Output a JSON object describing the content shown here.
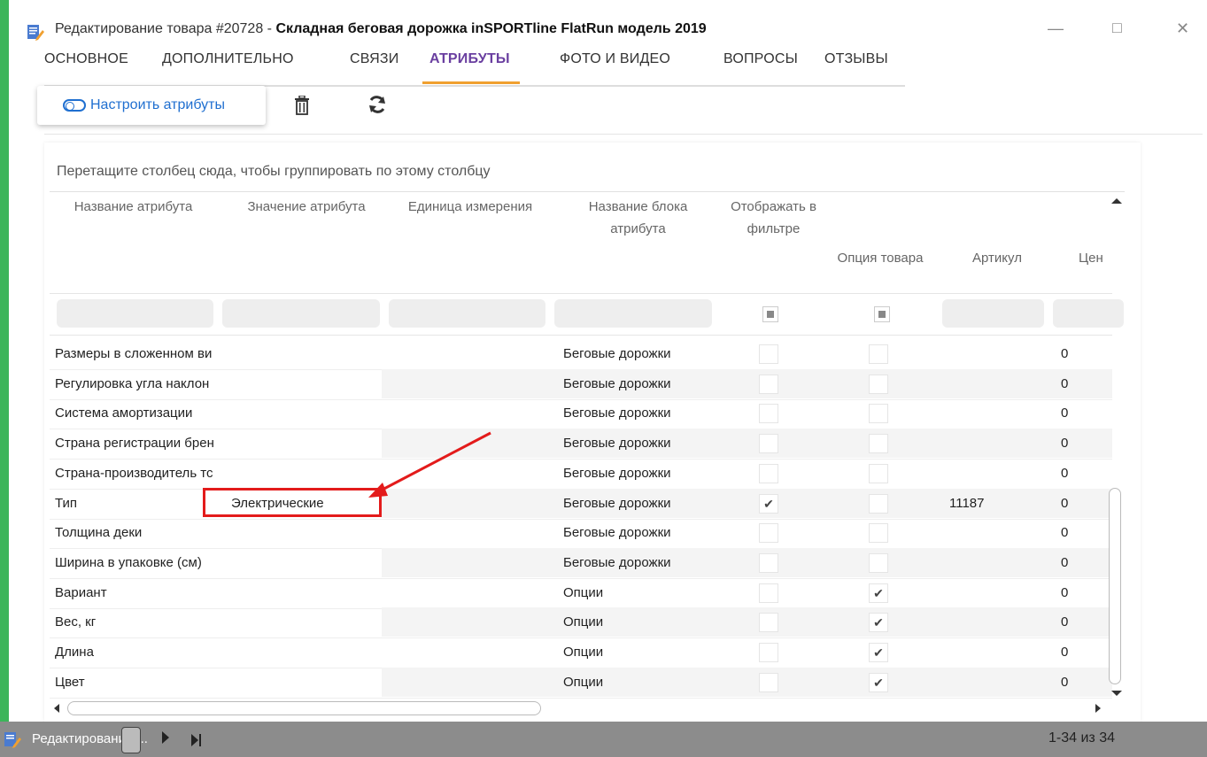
{
  "window": {
    "title_prefix": "Редактирование товара #20728 - ",
    "title_product": "Складная беговая дорожка inSPORTline FlatRun модель 2019"
  },
  "tabs": [
    {
      "label": "ОСНОВНОЕ"
    },
    {
      "label": "ДОПОЛНИТЕЛЬНО"
    },
    {
      "label": "СВЯЗИ"
    },
    {
      "label": "АТРИБУТЫ"
    },
    {
      "label": "ФОТО И ВИДЕО"
    },
    {
      "label": "ВОПРОСЫ"
    },
    {
      "label": "ОТЗЫВЫ"
    }
  ],
  "toolbar": {
    "configure_label": "Настроить атрибуты"
  },
  "grid": {
    "group_hint": "Перетащите столбец сюда, чтобы группировать по этому столбцу",
    "headers": {
      "name": "Название атрибута",
      "value": "Значение атрибута",
      "unit": "Единица измерения",
      "block_line1": "Название блока",
      "block_line2": "атрибута",
      "filter_line1": "Отображать в",
      "filter_line2": "фильтре",
      "option": "Опция товара",
      "sku": "Артикул",
      "price": "Цен"
    },
    "rows": [
      {
        "name": "Размеры в сложенном ви",
        "value": "",
        "block": "Беговые дорожки",
        "filter": false,
        "option": false,
        "sku": "",
        "price": "0"
      },
      {
        "name": "Регулировка угла наклон",
        "value": "",
        "block": "Беговые дорожки",
        "filter": false,
        "option": false,
        "sku": "",
        "price": "0"
      },
      {
        "name": "Система амортизации",
        "value": "",
        "block": "Беговые дорожки",
        "filter": false,
        "option": false,
        "sku": "",
        "price": "0"
      },
      {
        "name": "Страна регистрации брен",
        "value": "",
        "block": "Беговые дорожки",
        "filter": false,
        "option": false,
        "sku": "",
        "price": "0"
      },
      {
        "name": "Страна-производитель тс",
        "value": "",
        "block": "Беговые дорожки",
        "filter": false,
        "option": false,
        "sku": "",
        "price": "0"
      },
      {
        "name": "Тип",
        "value": "Электрические",
        "block": "Беговые дорожки",
        "filter": true,
        "option": false,
        "sku": "11187",
        "price": "0"
      },
      {
        "name": "Толщина деки",
        "value": "",
        "block": "Беговые дорожки",
        "filter": false,
        "option": false,
        "sku": "",
        "price": "0"
      },
      {
        "name": "Ширина в упаковке (см)",
        "value": "",
        "block": "Беговые дорожки",
        "filter": false,
        "option": false,
        "sku": "",
        "price": "0"
      },
      {
        "name": "Вариант",
        "value": "",
        "block": "Опции",
        "filter": false,
        "option": true,
        "sku": "",
        "price": "0"
      },
      {
        "name": "Вес, кг",
        "value": "",
        "block": "Опции",
        "filter": false,
        "option": true,
        "sku": "",
        "price": "0"
      },
      {
        "name": "Длина",
        "value": "",
        "block": "Опции",
        "filter": false,
        "option": true,
        "sku": "",
        "price": "0"
      },
      {
        "name": "Цвет",
        "value": "",
        "block": "Опции",
        "filter": false,
        "option": true,
        "sku": "",
        "price": "0"
      }
    ]
  },
  "taskbar": {
    "item_label": "Редактирование ...",
    "pager_text": "1-34 из 34"
  },
  "colors": {
    "accent_tab": "#6a3fa0",
    "tab_underline": "#f0a030",
    "button_blue": "#1f6fd0",
    "annotation_red": "#e31b1b",
    "side_green": "#3cb55a"
  }
}
